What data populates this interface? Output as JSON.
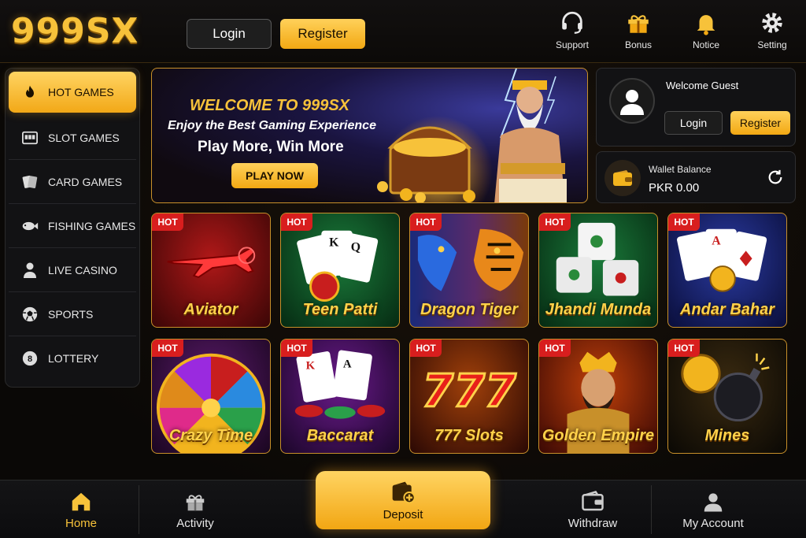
{
  "header": {
    "logo": "999SX",
    "login_label": "Login",
    "register_label": "Register",
    "icons": [
      {
        "name": "support-icon",
        "label": "Support"
      },
      {
        "name": "bonus-icon",
        "label": "Bonus"
      },
      {
        "name": "notice-icon",
        "label": "Notice"
      },
      {
        "name": "setting-icon",
        "label": "Setting"
      }
    ]
  },
  "sidebar": {
    "items": [
      {
        "label": "HOT GAMES",
        "icon": "fire-icon",
        "active": true
      },
      {
        "label": "SLOT GAMES",
        "icon": "slot-machine-icon"
      },
      {
        "label": "CARD GAMES",
        "icon": "cards-icon"
      },
      {
        "label": "FISHING GAMES",
        "icon": "fish-icon"
      },
      {
        "label": "LIVE CASINO",
        "icon": "dealer-icon"
      },
      {
        "label": "SPORTS",
        "icon": "soccer-ball-icon"
      },
      {
        "label": "LOTTERY",
        "icon": "lottery-ball-icon"
      }
    ]
  },
  "banner": {
    "title": "WELCOME TO 999SX",
    "subtitle": "Enjoy the Best Gaming Experience",
    "tagline": "Play More, Win More",
    "cta": "PLAY NOW"
  },
  "user_panel": {
    "welcome": "Welcome Guest",
    "login_label": "Login",
    "register_label": "Register"
  },
  "wallet": {
    "label": "Wallet Balance",
    "amount": "PKR 0.00"
  },
  "games": {
    "badge": "HOT",
    "items": [
      {
        "name": "Aviator"
      },
      {
        "name": "Teen Patti"
      },
      {
        "name": "Dragon Tiger"
      },
      {
        "name": "Jhandi Munda"
      },
      {
        "name": "Andar Bahar"
      },
      {
        "name": "Crazy Time"
      },
      {
        "name": "Baccarat"
      },
      {
        "name": "777 Slots"
      },
      {
        "name": "Golden Empire"
      },
      {
        "name": "Mines"
      }
    ]
  },
  "bottom_nav": {
    "home": "Home",
    "activity": "Activity",
    "deposit": "Deposit",
    "withdraw": "Withdraw",
    "account": "My Account"
  },
  "colors": {
    "accent": "#f7c23a",
    "accent_dark": "#f2a813",
    "hot_badge": "#d81e1e",
    "background": "#0a0806"
  }
}
